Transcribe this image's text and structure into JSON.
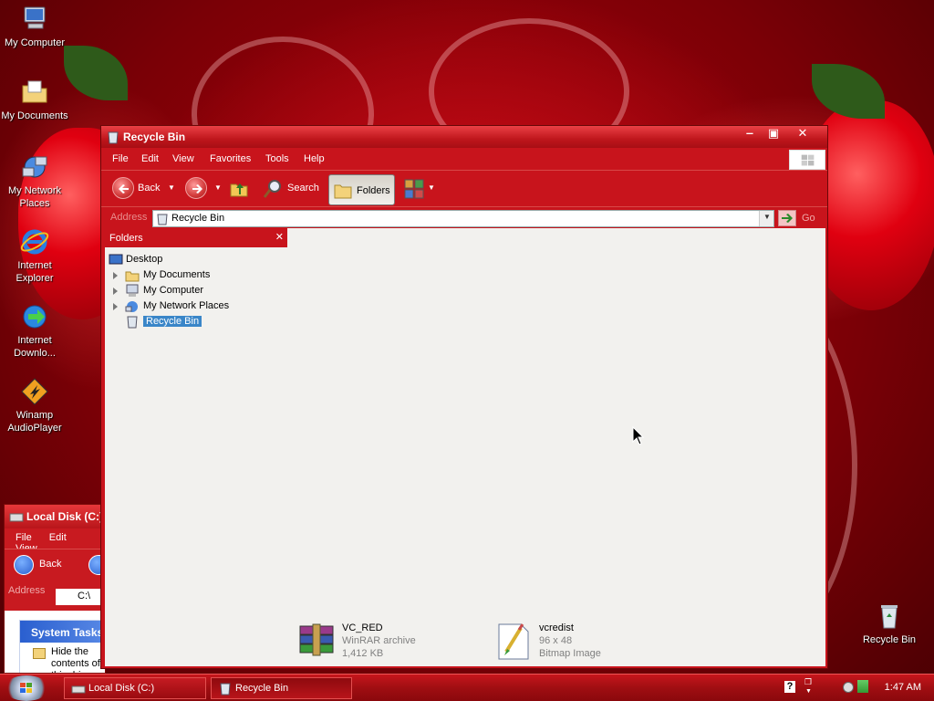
{
  "desktop": {
    "icons": [
      {
        "label": "My Computer",
        "icon": "my-computer-icon"
      },
      {
        "label": "My Documents",
        "icon": "my-documents-icon"
      },
      {
        "label": "My Network Places",
        "icon": "network-places-icon"
      },
      {
        "label": "Internet Explorer",
        "icon": "internet-explorer-icon"
      },
      {
        "label": "Internet Downlo...",
        "icon": "internet-download-manager-icon"
      },
      {
        "label": "Winamp AudioPlayer",
        "icon": "winamp-icon"
      },
      {
        "label": "Recycle Bin",
        "icon": "recycle-bin-icon"
      }
    ]
  },
  "back_window": {
    "title": "Local Disk (C:)",
    "menu": [
      "File",
      "Edit",
      "View"
    ],
    "back_label": "Back",
    "address_label": "Address",
    "address_value": "C:\\",
    "task_header": "System Tasks",
    "task_item": "Hide the contents of this drive"
  },
  "window": {
    "title": "Recycle Bin",
    "menu": [
      "File",
      "Edit",
      "View",
      "Favorites",
      "Tools",
      "Help"
    ],
    "toolbar": {
      "back_label": "Back",
      "search_label": "Search",
      "folders_label": "Folders"
    },
    "address": {
      "label": "Address",
      "value": "Recycle Bin",
      "go_label": "Go"
    },
    "folders_pane": {
      "title": "Folders",
      "tree": [
        {
          "label": "Desktop",
          "level": 0
        },
        {
          "label": "My Documents",
          "level": 1
        },
        {
          "label": "My Computer",
          "level": 1
        },
        {
          "label": "My Network Places",
          "level": 1
        },
        {
          "label": "Recycle Bin",
          "level": 1,
          "selected": true
        }
      ]
    },
    "files": [
      {
        "name": "VC_RED",
        "type": "WinRAR archive",
        "size": "1,412 KB",
        "icon": "winrar-archive-icon"
      },
      {
        "name": "vcredist",
        "type": "96 x 48",
        "size": "Bitmap Image",
        "icon": "bitmap-image-icon"
      }
    ]
  },
  "taskbar": {
    "buttons": [
      "Local Disk (C:)",
      "Recycle Bin"
    ],
    "clock": "1:47 AM"
  },
  "colors": {
    "chrome_red": "#c8141c",
    "selection_blue": "#3a86c8"
  }
}
